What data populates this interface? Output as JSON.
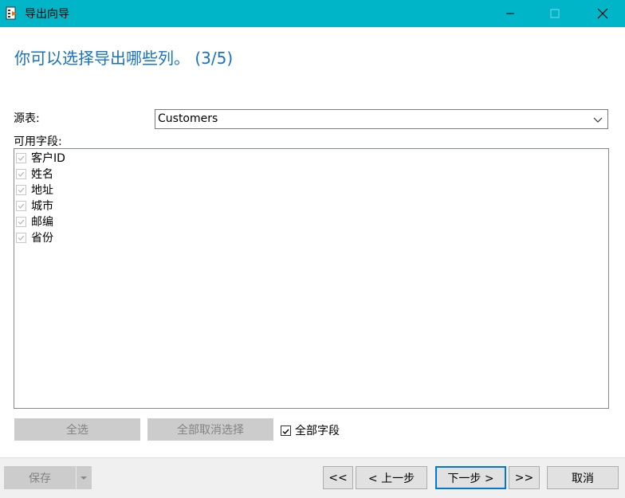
{
  "window": {
    "title": "导出向导",
    "titlebar_color": "#00b5c8"
  },
  "heading": "你可以选择导出哪些列。 (3/5)",
  "source": {
    "label": "源表:",
    "value": "Customers"
  },
  "fields": {
    "label": "可用字段:",
    "items": [
      "客户ID",
      "姓名",
      "地址",
      "城市",
      "邮编",
      "省份"
    ]
  },
  "actions": {
    "select_all": "全选",
    "deselect_all": "全部取消选择",
    "all_fields": "全部字段"
  },
  "footer": {
    "save": "保存",
    "first": "<<",
    "prev": "< 上一步",
    "next": "下一步 >",
    "last": ">>",
    "cancel": "取消"
  }
}
